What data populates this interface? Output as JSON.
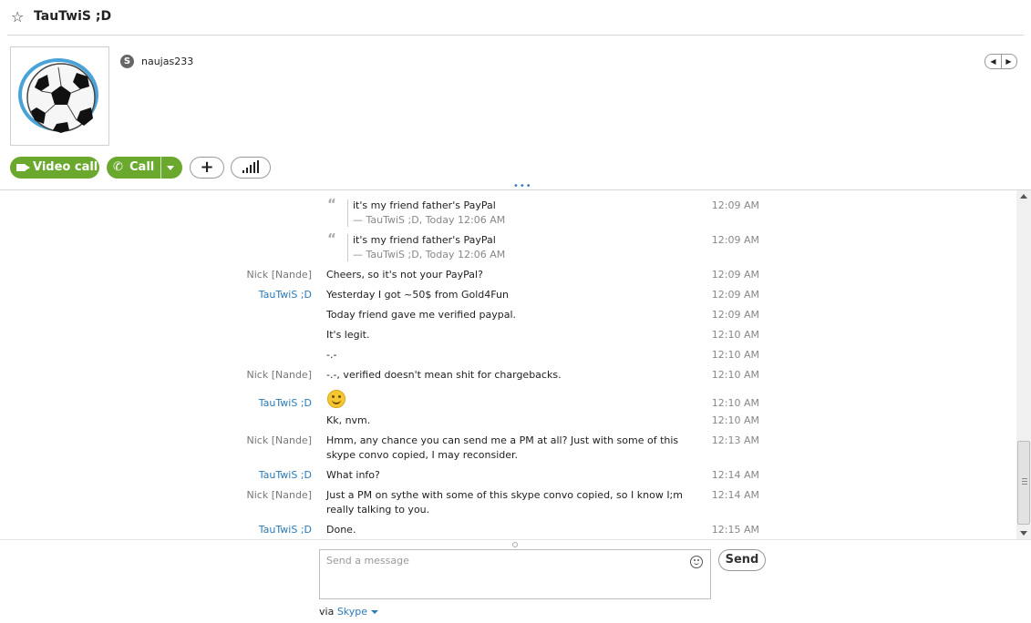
{
  "header": {
    "title": "TauTwiS ;D"
  },
  "profile": {
    "username": "naujas233",
    "skype_badge": "S"
  },
  "actions": {
    "video_call": "Video call",
    "call": "Call",
    "add": "+"
  },
  "messages": [
    {
      "type": "quote",
      "text": "it's my friend father's PayPal",
      "attribution": "— TauTwiS ;D, Today 12:06 AM",
      "time": "12:09 AM"
    },
    {
      "type": "quote",
      "text": "it's my friend father's PayPal",
      "attribution": "— TauTwiS ;D, Today 12:06 AM",
      "time": "12:09 AM"
    },
    {
      "sender": "Nick [Nande]",
      "text": "Cheers, so it's not your PayPal?",
      "time": "12:09 AM"
    },
    {
      "sender": "TauTwiS ;D",
      "text": "Yesterday I got ~50$ from Gold4Fun",
      "time": "12:09 AM"
    },
    {
      "sender": "",
      "text": "Today friend gave me verified paypal.",
      "time": "12:09 AM"
    },
    {
      "sender": "",
      "text": "It's legit.",
      "time": "12:10 AM"
    },
    {
      "sender": "",
      "text": "-.-",
      "time": "12:10 AM"
    },
    {
      "sender": "Nick [Nande]",
      "text": "-.-, verified doesn't mean shit for chargebacks.",
      "time": "12:10 AM"
    },
    {
      "sender": "TauTwiS ;D",
      "text": "",
      "emoticon": "smile",
      "time": "12:10 AM"
    },
    {
      "sender": "",
      "text": "Kk, nvm.",
      "time": "12:10 AM"
    },
    {
      "sender": "Nick [Nande]",
      "text": "Hmm, any chance you can send me a PM at all? Just with some of this skype convo copied, I may reconsider.",
      "time": "12:13 AM"
    },
    {
      "sender": "TauTwiS ;D",
      "text": "What info?",
      "time": "12:14 AM"
    },
    {
      "sender": "Nick [Nande]",
      "text": "Just a PM on sythe with some of this skype convo copied, so I know I;m really talking to you.",
      "time": "12:14 AM"
    },
    {
      "sender": "TauTwiS ;D",
      "text": "Done.",
      "time": "12:15 AM"
    }
  ],
  "compose": {
    "placeholder": "Send a message",
    "send_label": "Send",
    "via_prefix": "via",
    "via_service": "Skype"
  },
  "colors": {
    "accent_green": "#6aa82e",
    "link_blue": "#2a7bb8"
  }
}
